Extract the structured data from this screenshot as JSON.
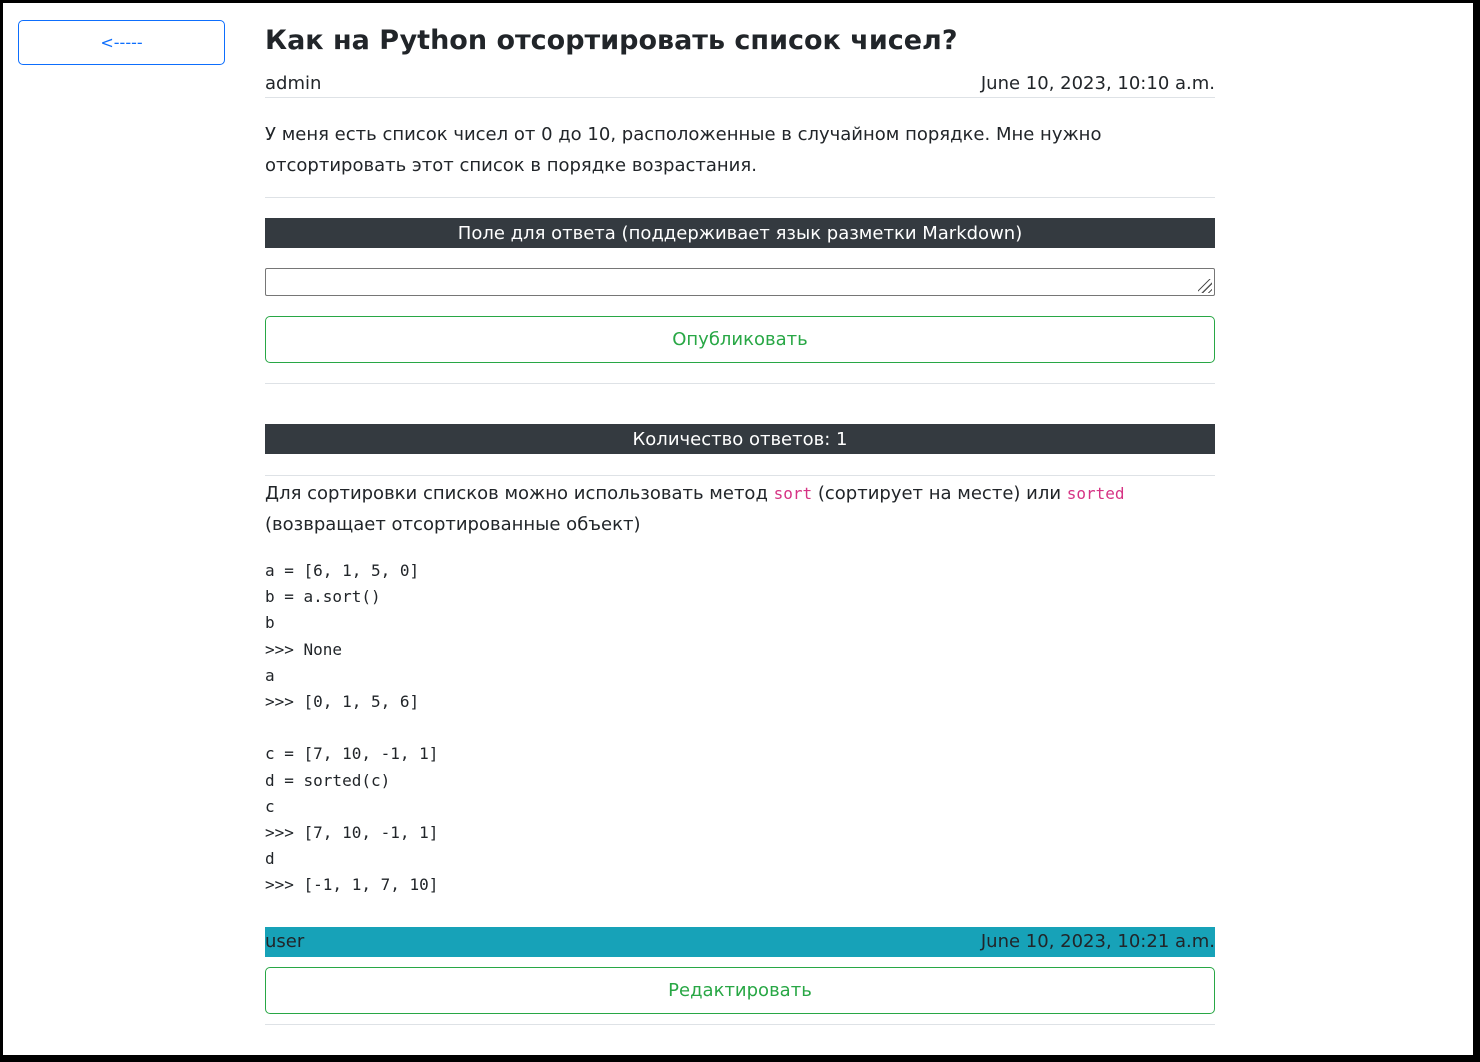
{
  "nav": {
    "back_label": "<-----"
  },
  "question": {
    "title": "Как на Python отсортировать список чисел?",
    "author": "admin",
    "date": "June 10, 2023, 10:10 a.m.",
    "body": "У меня есть список чисел от 0 до 10, расположенные в случайном порядке. Мне нужно отсортировать этот список в порядке возрастания."
  },
  "answer_form": {
    "header": "Поле для ответа (поддерживает язык разметки Markdown)",
    "input_value": "",
    "submit_label": "Опубликовать"
  },
  "answers_section": {
    "count_label": "Количество ответов: 1"
  },
  "answer": {
    "text_before": "Для сортировки списков можно испoльзовать метод ",
    "code_sort": "sort",
    "text_middle": " (сортирует на месте) или ",
    "code_sorted": "sorted",
    "text_after": " (возвращает отсортированные объект)",
    "code_lines": [
      "a = [6, 1, 5, 0]",
      "b = a.sort()",
      "b",
      ">>> None",
      "a",
      ">>> [0, 1, 5, 6]",
      "",
      "c = [7, 10, -1, 1]",
      "d = sorted(c)",
      "c",
      ">>> [7, 10, -1, 1]",
      "d",
      ">>> [-1, 1, 7, 10]"
    ],
    "author": "user",
    "date": "June 10, 2023, 10:21 a.m.",
    "edit_label": "Редактировать"
  },
  "colors": {
    "primary": "#0d6efd",
    "success": "#28a745",
    "dark": "#343a40",
    "info": "#17a2b8",
    "code": "#d63384"
  }
}
